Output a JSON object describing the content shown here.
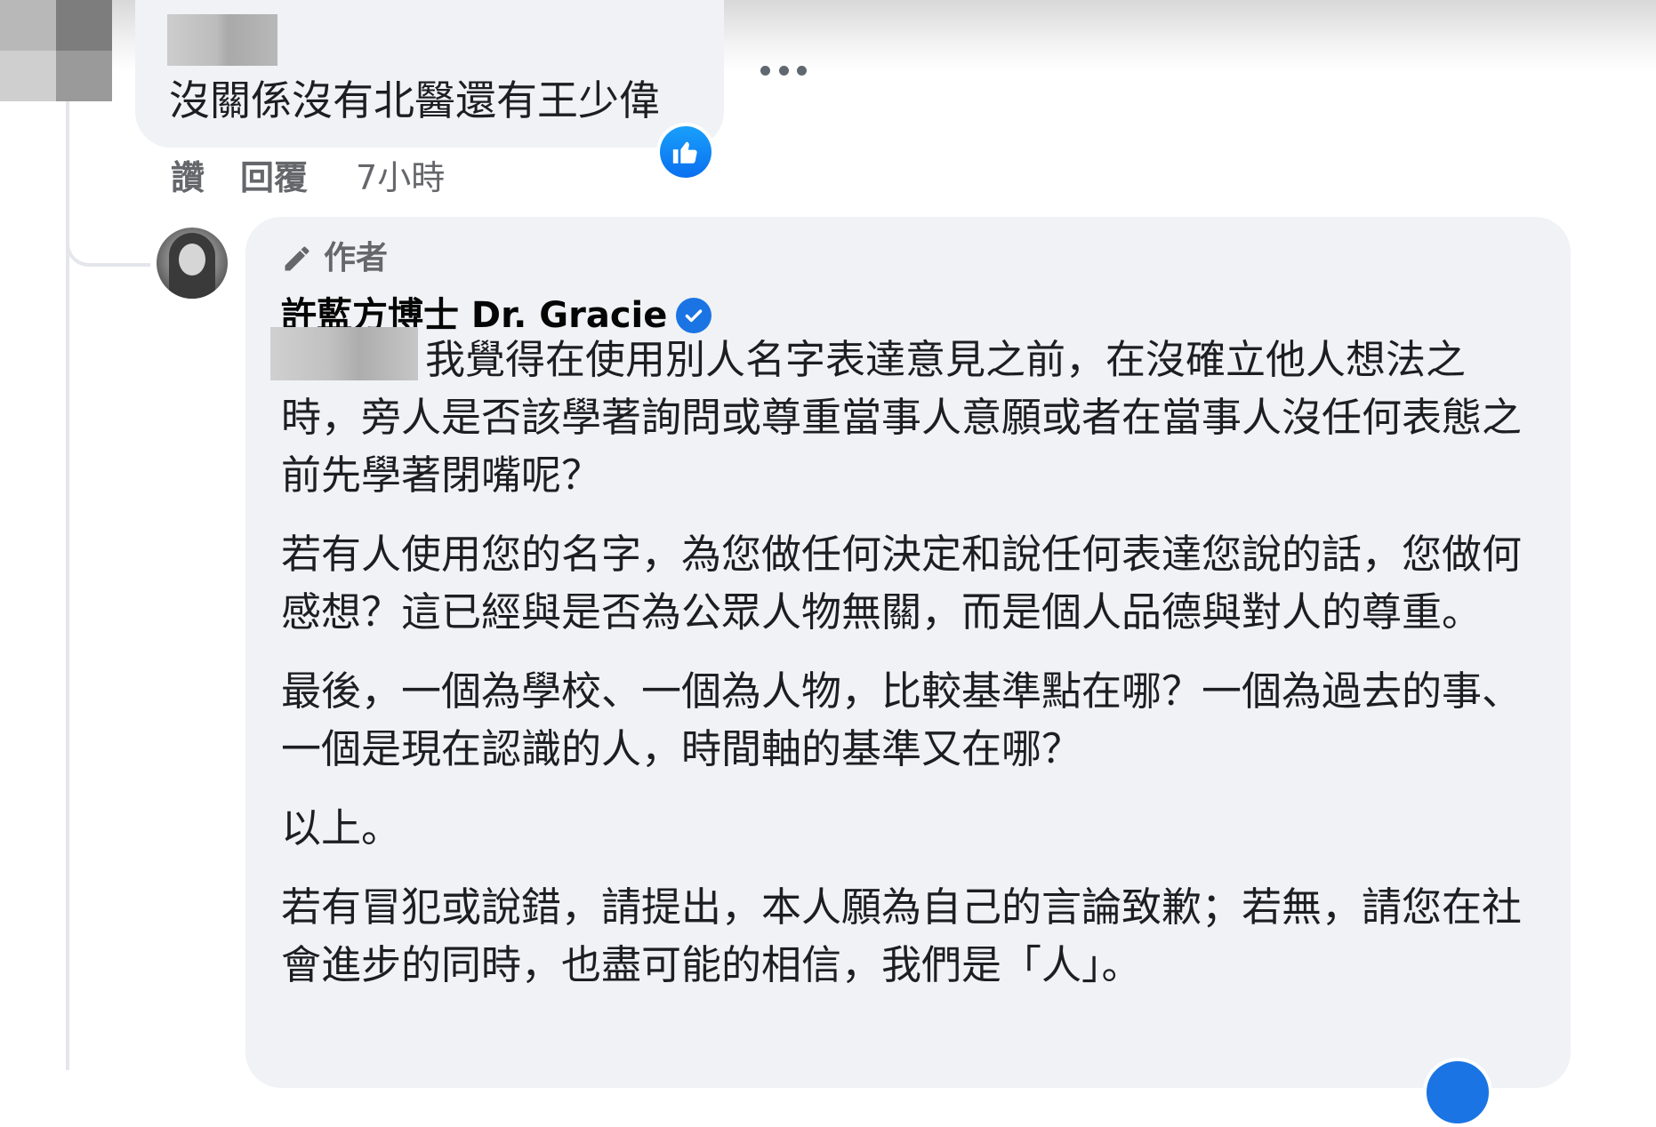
{
  "comment": {
    "text": "沒關係沒有北醫還有王少偉",
    "actions": {
      "like": "讚",
      "reply": "回覆",
      "time": "7小時"
    }
  },
  "reply": {
    "badge": "作者",
    "author": "許藍方博士 Dr. Gracie",
    "paragraphs": [
      "我覺得在使用別人名字表達意見之前，在沒確立他人想法之時，旁人是否該學著詢問或尊重當事人意願或者在當事人沒任何表態之前先學著閉嘴呢？",
      "若有人使用您的名字，為您做任何決定和說任何表達您說的話，您做何感想？這已經與是否為公眾人物無關，而是個人品德與對人的尊重。",
      "最後，一個為學校、一個為人物，比較基準點在哪？一個為過去的事、一個是現在認識的人，時間軸的基準又在哪？",
      "以上。",
      "若有冒犯或說錯，請提出，本人願為自己的言論致歉；若無，請您在社會進步的同時，也盡可能的相信，我們是「人」。"
    ]
  },
  "icons": {
    "more": "more-options-icon",
    "like_reaction": "like-reaction-icon",
    "pencil": "pencil-icon",
    "verified": "verified-badge-icon"
  },
  "colors": {
    "bubble": "#f0f2f5",
    "meta_text": "#65676b",
    "facebook_blue": "#1b74e4"
  }
}
